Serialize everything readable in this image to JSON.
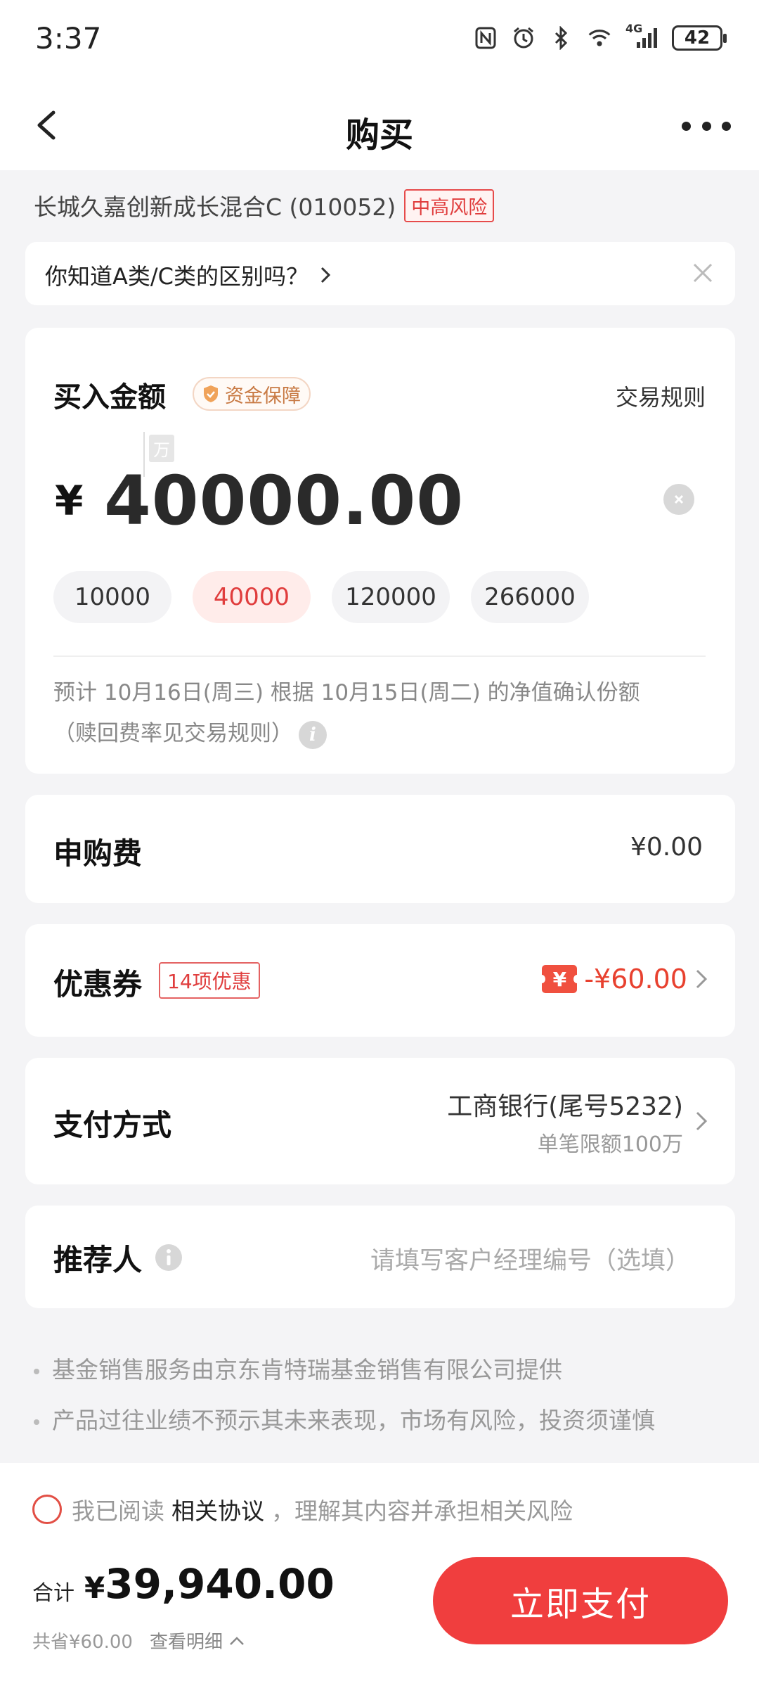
{
  "status_bar": {
    "time": "3:37",
    "network": "4G",
    "battery": "42"
  },
  "nav": {
    "title": "购买"
  },
  "fund": {
    "name": "长城久嘉创新成长混合C (010052)",
    "risk": "中高风险"
  },
  "tip": {
    "text": "你知道A类/C类的区别吗？"
  },
  "amount": {
    "label": "买入金额",
    "guarantee": "资金保障",
    "rules_link": "交易规则",
    "unit_hint": "万",
    "currency": "¥",
    "value": "40000.00",
    "chips": [
      {
        "label": "10000"
      },
      {
        "label": "40000"
      },
      {
        "label": "120000"
      },
      {
        "label": "266000"
      }
    ],
    "estimate_line1": "预计 10月16日(周三) 根据 10月15日(周二) 的净值确认份额",
    "estimate_line2": "（赎回费率见交易规则）"
  },
  "fee": {
    "label": "申购费",
    "value": "¥0.00"
  },
  "coupon": {
    "label": "优惠券",
    "badge": "14项优惠",
    "icon_text": "¥",
    "value": "-¥60.00"
  },
  "payment": {
    "label": "支付方式",
    "bank": "工商银行(尾号5232)",
    "limit": "单笔限额100万"
  },
  "referrer": {
    "label": "推荐人",
    "placeholder": "请填写客户经理编号（选填）"
  },
  "notes": [
    "基金销售服务由京东肯特瑞基金销售有限公司提供",
    "产品过往业绩不预示其未来表现，市场有风险，投资须谨慎"
  ],
  "agreement": {
    "prefix": "我已阅读",
    "link": "相关协议",
    "suffix": "，理解其内容并承担相关风险"
  },
  "total": {
    "label": "合计",
    "currency": "¥",
    "value": "39,940.00",
    "saved": "共省¥60.00",
    "detail": "查看明细"
  },
  "pay_button": {
    "label": "立即支付"
  }
}
